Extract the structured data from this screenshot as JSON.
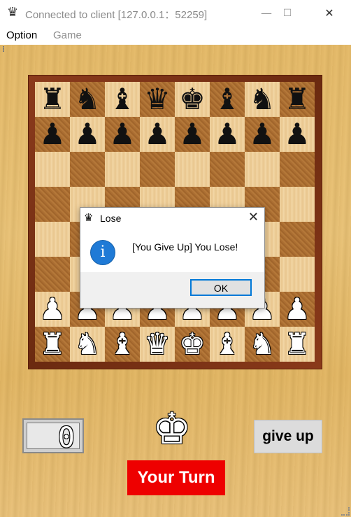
{
  "window": {
    "title": "Connected to client [127.0.0.1：52259]",
    "app_icon": "♛",
    "minimize": "—",
    "maximize": "☐",
    "close": "✕"
  },
  "menu": {
    "items": [
      {
        "label": "Option",
        "enabled": true
      },
      {
        "label": "Game",
        "enabled": false
      }
    ]
  },
  "board": {
    "rows": [
      [
        {
          "p": "♜",
          "c": "black"
        },
        {
          "p": "♞",
          "c": "black"
        },
        {
          "p": "♝",
          "c": "black"
        },
        {
          "p": "♛",
          "c": "black"
        },
        {
          "p": "♚",
          "c": "black"
        },
        {
          "p": "♝",
          "c": "black"
        },
        {
          "p": "♞",
          "c": "black"
        },
        {
          "p": "♜",
          "c": "black"
        }
      ],
      [
        {
          "p": "♟",
          "c": "black"
        },
        {
          "p": "♟",
          "c": "black"
        },
        {
          "p": "♟",
          "c": "black"
        },
        {
          "p": "♟",
          "c": "black"
        },
        {
          "p": "♟",
          "c": "black"
        },
        {
          "p": "♟",
          "c": "black"
        },
        {
          "p": "♟",
          "c": "black"
        },
        {
          "p": "♟",
          "c": "black"
        }
      ],
      [
        {
          "p": "",
          "c": ""
        },
        {
          "p": "",
          "c": ""
        },
        {
          "p": "",
          "c": ""
        },
        {
          "p": "",
          "c": ""
        },
        {
          "p": "",
          "c": ""
        },
        {
          "p": "",
          "c": ""
        },
        {
          "p": "",
          "c": ""
        },
        {
          "p": "",
          "c": ""
        }
      ],
      [
        {
          "p": "",
          "c": ""
        },
        {
          "p": "",
          "c": ""
        },
        {
          "p": "",
          "c": ""
        },
        {
          "p": "",
          "c": ""
        },
        {
          "p": "",
          "c": ""
        },
        {
          "p": "",
          "c": ""
        },
        {
          "p": "",
          "c": ""
        },
        {
          "p": "",
          "c": ""
        }
      ],
      [
        {
          "p": "",
          "c": ""
        },
        {
          "p": "",
          "c": ""
        },
        {
          "p": "",
          "c": ""
        },
        {
          "p": "",
          "c": ""
        },
        {
          "p": "",
          "c": ""
        },
        {
          "p": "",
          "c": ""
        },
        {
          "p": "",
          "c": ""
        },
        {
          "p": "",
          "c": ""
        }
      ],
      [
        {
          "p": "",
          "c": ""
        },
        {
          "p": "",
          "c": ""
        },
        {
          "p": "",
          "c": ""
        },
        {
          "p": "",
          "c": ""
        },
        {
          "p": "",
          "c": ""
        },
        {
          "p": "",
          "c": ""
        },
        {
          "p": "",
          "c": ""
        },
        {
          "p": "",
          "c": ""
        }
      ],
      [
        {
          "p": "♟",
          "c": "white"
        },
        {
          "p": "♟",
          "c": "white"
        },
        {
          "p": "♟",
          "c": "white"
        },
        {
          "p": "♟",
          "c": "white"
        },
        {
          "p": "♟",
          "c": "white"
        },
        {
          "p": "♟",
          "c": "white"
        },
        {
          "p": "♟",
          "c": "white"
        },
        {
          "p": "♟",
          "c": "white"
        }
      ],
      [
        {
          "p": "♜",
          "c": "white"
        },
        {
          "p": "♞",
          "c": "white"
        },
        {
          "p": "♝",
          "c": "white"
        },
        {
          "p": "♛",
          "c": "white"
        },
        {
          "p": "♚",
          "c": "white"
        },
        {
          "p": "♝",
          "c": "white"
        },
        {
          "p": "♞",
          "c": "white"
        },
        {
          "p": "♜",
          "c": "white"
        }
      ]
    ]
  },
  "dialog": {
    "title": "Lose",
    "icon": "♛",
    "close": "✕",
    "info_icon": "i",
    "message": "[You Give Up] You Lose!",
    "ok_label": "OK"
  },
  "status": {
    "counter": "0",
    "turn_piece": "♚",
    "turn_label": "Your Turn",
    "give_up_label": "give up"
  },
  "colors": {
    "turn_background": "#ee0000",
    "info_icon": "#1f7ad6",
    "ok_border": "#0078d7"
  }
}
